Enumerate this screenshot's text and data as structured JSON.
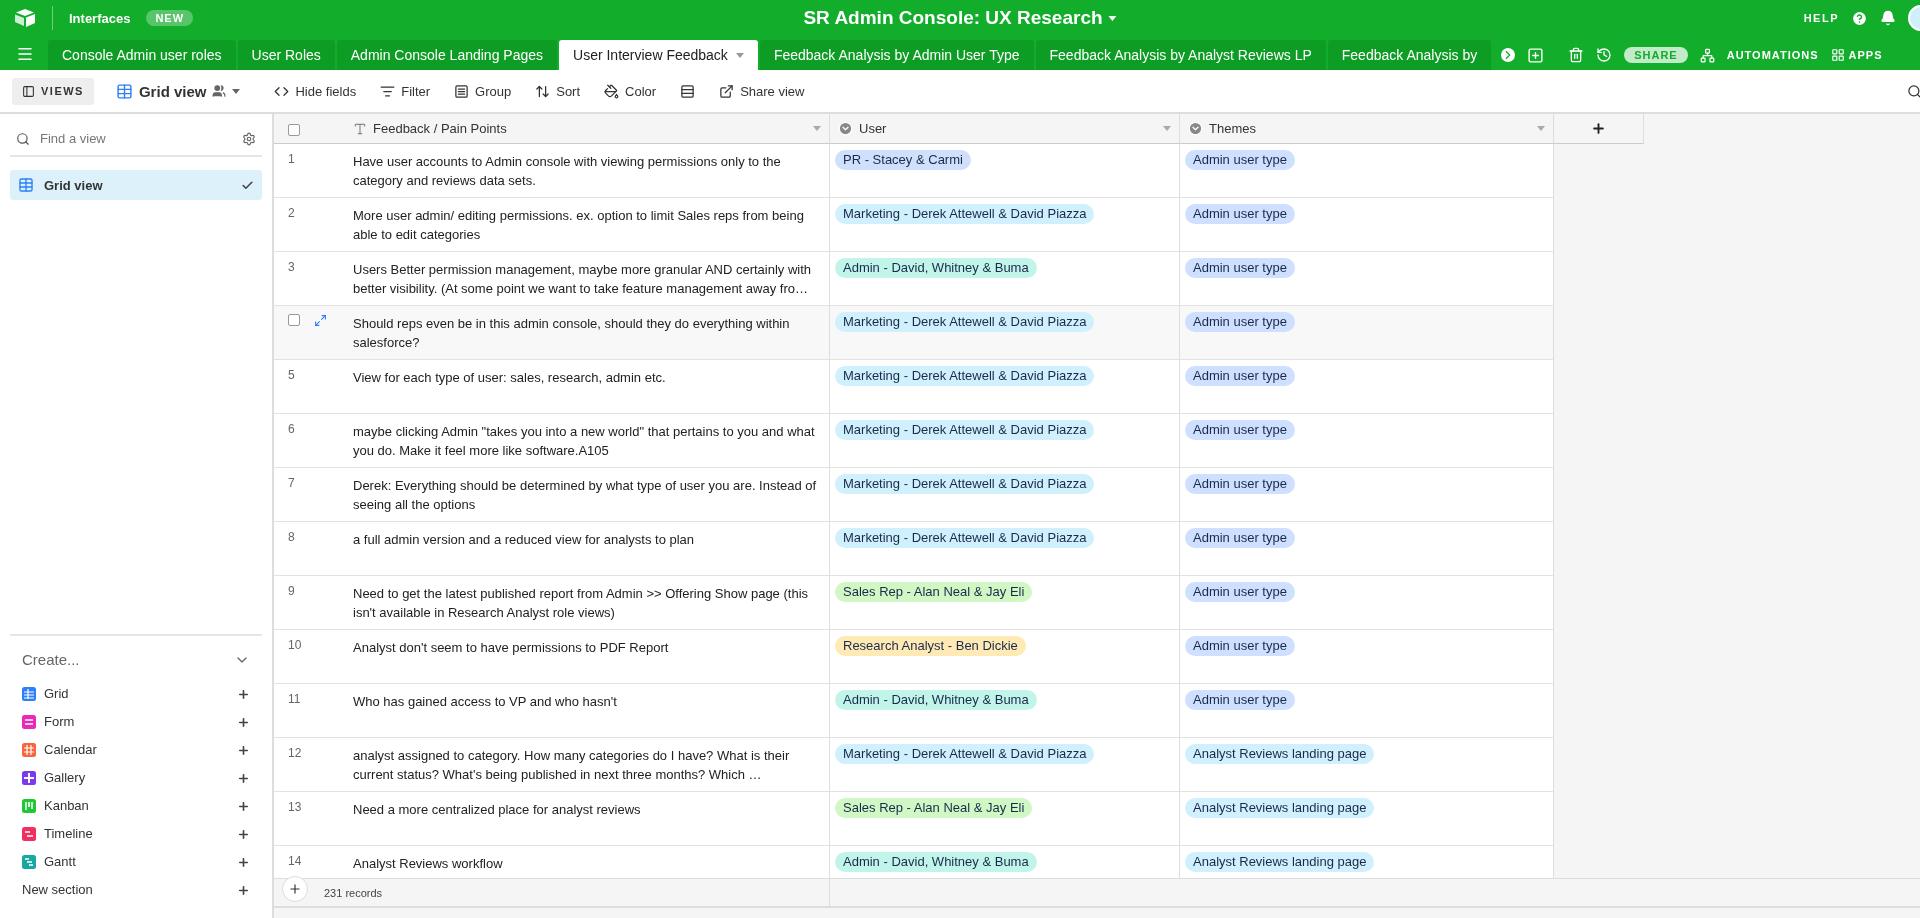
{
  "top_bar": {
    "interfaces": "Interfaces",
    "badge": "NEW",
    "title": "SR Admin Console: UX Research",
    "help": "HELP"
  },
  "tabs": [
    {
      "label": "Console Admin user roles",
      "selected": false
    },
    {
      "label": "User Roles",
      "selected": false
    },
    {
      "label": "Admin Console Landing Pages",
      "selected": false
    },
    {
      "label": "User Interview Feedback",
      "selected": true
    },
    {
      "label": "Feedback Analysis by Admin User Type",
      "selected": false
    },
    {
      "label": "Feedback Analysis by Analyst Reviews LP",
      "selected": false
    },
    {
      "label": "Feedback Analysis by",
      "selected": false
    }
  ],
  "tab_actions": {
    "share": "SHARE",
    "automations": "AUTOMATIONS",
    "apps": "APPS"
  },
  "toolbar": {
    "views": "VIEWS",
    "view_name": "Grid view",
    "buttons": [
      {
        "kind": "hide",
        "label": "Hide fields"
      },
      {
        "kind": "filter",
        "label": "Filter"
      },
      {
        "kind": "group",
        "label": "Group"
      },
      {
        "kind": "sort",
        "label": "Sort"
      },
      {
        "kind": "color",
        "label": "Color"
      },
      {
        "kind": "height"
      },
      {
        "kind": "share",
        "label": "Share view"
      }
    ]
  },
  "sidebar": {
    "search": {
      "placeholder": "Find a view"
    },
    "views": [
      {
        "label": "Grid view",
        "selected": true
      }
    ],
    "create": {
      "title": "Create...",
      "items": [
        {
          "kind": "grid",
          "label": "Grid",
          "color": "#2d7ff9"
        },
        {
          "kind": "form",
          "label": "Form",
          "color": "#e929ba"
        },
        {
          "kind": "calendar",
          "label": "Calendar",
          "color": "#f7653b"
        },
        {
          "kind": "gallery",
          "label": "Gallery",
          "color": "#7c39ed"
        },
        {
          "kind": "kanban",
          "label": "Kanban",
          "color": "#20c933"
        },
        {
          "kind": "timeline",
          "label": "Timeline",
          "color": "#ef3061"
        },
        {
          "kind": "gantt",
          "label": "Gantt",
          "color": "#17a9a1"
        }
      ],
      "new_section": "New section"
    }
  },
  "table": {
    "columns": [
      {
        "kind": "text",
        "name": "Feedback / Pain Points"
      },
      {
        "kind": "select",
        "name": "User"
      },
      {
        "kind": "select",
        "name": "Themes"
      }
    ],
    "rows": [
      {
        "number": "1",
        "hovered": false,
        "feedback": "Have user accounts to Admin console with viewing permissions only to the category and reviews data sets.",
        "user": {
          "label": "PR - Stacey & Carmi",
          "color": "#d0e0fc"
        },
        "theme": {
          "label": "Admin user type",
          "color": "#cfdfff"
        }
      },
      {
        "number": "2",
        "hovered": false,
        "feedback": "More user admin/ editing permissions. ex. option to limit Sales reps from being able to edit categories",
        "user": {
          "label": "Marketing - Derek Attewell & David Piazza",
          "color": "#d0f0fd"
        },
        "theme": {
          "label": "Admin user type",
          "color": "#cfdfff"
        }
      },
      {
        "number": "3",
        "hovered": false,
        "feedback": "Users Better permission management, maybe more granular AND certainly with better visibility.  (At some point we want to take feature management away fro…",
        "user": {
          "label": "Admin - David, Whitney & Buma",
          "color": "#c2f5e9"
        },
        "theme": {
          "label": "Admin user type",
          "color": "#cfdfff"
        }
      },
      {
        "hovered": true,
        "checked": false,
        "feedback": "Should reps even be in this admin console, should they do everything within salesforce?",
        "user": {
          "label": "Marketing - Derek Attewell & David Piazza",
          "color": "#d0f0fd"
        },
        "theme": {
          "label": "Admin user type",
          "color": "#cfdfff"
        }
      },
      {
        "number": "5",
        "hovered": false,
        "feedback": "View for each type of user: sales, research, admin etc.",
        "user": {
          "label": "Marketing - Derek Attewell & David Piazza",
          "color": "#d0f0fd"
        },
        "theme": {
          "label": "Admin user type",
          "color": "#cfdfff"
        }
      },
      {
        "number": "6",
        "hovered": false,
        "feedback": " maybe clicking Admin \"takes you into a new world\" that pertains to you and what you do.  Make it feel more like software.A105",
        "user": {
          "label": "Marketing - Derek Attewell & David Piazza",
          "color": "#d0f0fd"
        },
        "theme": {
          "label": "Admin user type",
          "color": "#cfdfff"
        }
      },
      {
        "number": "7",
        "hovered": false,
        "feedback": "Derek:  Everything should be determined by what type of user you are.  Instead of seeing all the options",
        "user": {
          "label": "Marketing - Derek Attewell & David Piazza",
          "color": "#d0f0fd"
        },
        "theme": {
          "label": "Admin user type",
          "color": "#cfdfff"
        }
      },
      {
        "number": "8",
        "hovered": false,
        "feedback": " a full admin version and a reduced view for analysts to plan",
        "user": {
          "label": "Marketing - Derek Attewell & David Piazza",
          "color": "#d0f0fd"
        },
        "theme": {
          "label": "Admin user type",
          "color": "#cfdfff"
        }
      },
      {
        "number": "9",
        "hovered": false,
        "feedback": "Need to get the latest published report from Admin >> Offering Show page (this isn't available in Research Analyst role views)",
        "user": {
          "label": "Sales Rep - Alan Neal & Jay Eli",
          "color": "#d1f7c4"
        },
        "theme": {
          "label": "Admin user type",
          "color": "#cfdfff"
        }
      },
      {
        "number": "10",
        "hovered": false,
        "feedback": "Analyst don't seem to have permissions to PDF Report",
        "user": {
          "label": "Research Analyst - Ben Dickie",
          "color": "#ffeab6"
        },
        "theme": {
          "label": "Admin user type",
          "color": "#cfdfff"
        }
      },
      {
        "number": "11",
        "hovered": false,
        "feedback": "Who has gained access to VP and who hasn't",
        "user": {
          "label": "Admin - David, Whitney & Buma",
          "color": "#c2f5e9"
        },
        "theme": {
          "label": "Admin user type",
          "color": "#cfdfff"
        }
      },
      {
        "number": "12",
        "hovered": false,
        "feedback": " analyst assigned to category.  How many categories do I have?  What is their current status?  What's being published in next three months?  Which …",
        "user": {
          "label": "Marketing - Derek Attewell & David Piazza",
          "color": "#d0f0fd"
        },
        "theme": {
          "label": "Analyst Reviews landing page",
          "color": "#d0f0fd"
        }
      },
      {
        "number": "13",
        "hovered": false,
        "feedback": "Need a more centralized place for analyst reviews",
        "user": {
          "label": "Sales Rep - Alan Neal & Jay Eli",
          "color": "#d1f7c4"
        },
        "theme": {
          "label": "Analyst Reviews landing page",
          "color": "#d0f0fd"
        }
      },
      {
        "number": "14",
        "hovered": false,
        "feedback": "Analyst Reviews workflow",
        "user": {
          "label": "Admin - David, Whitney & Buma",
          "color": "#c2f5e9"
        },
        "theme": {
          "label": "Analyst Reviews landing page",
          "color": "#d0f0fd"
        }
      }
    ],
    "select_all": {
      "checked": false
    },
    "record_count": "231 records"
  }
}
